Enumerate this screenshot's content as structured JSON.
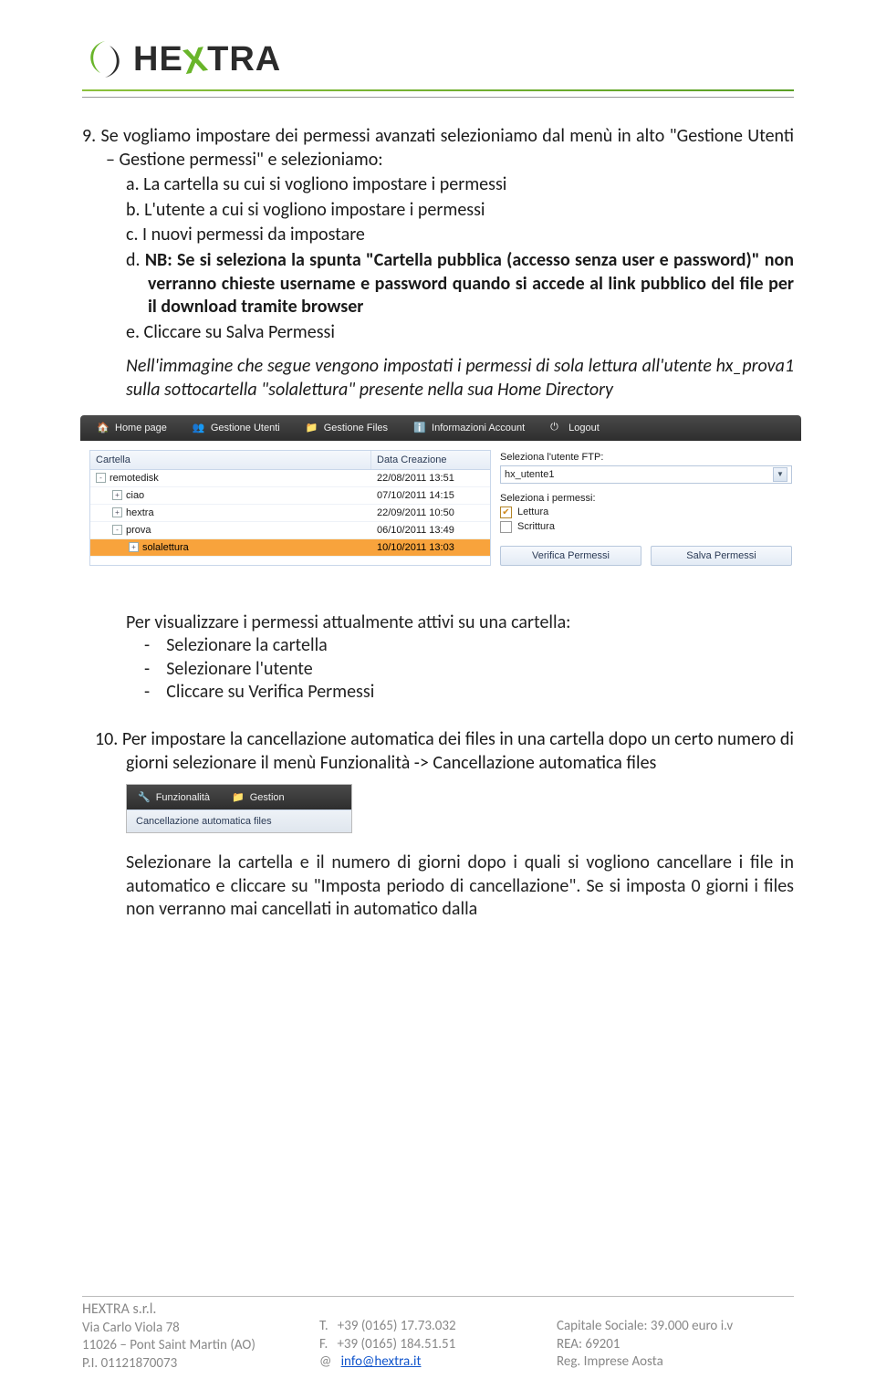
{
  "logo": {
    "text_pre": "HE",
    "text_x": "X",
    "text_post": "TRA"
  },
  "section9": {
    "num": "9.",
    "intro": "Se vogliamo impostare dei permessi avanzati selezioniamo dal menù in alto \"Gestione Utenti – Gestione permessi\" e selezioniamo:",
    "a": "a.",
    "a_txt": "La cartella su cui si vogliono impostare i permessi",
    "b": "b.",
    "b_txt": "L'utente a cui si vogliono impostare i permessi",
    "c": "c.",
    "c_txt": "I nuovi permessi da impostare",
    "d": "d.",
    "d_txt": "NB: Se si seleziona la spunta \"Cartella pubblica (accesso senza user e password)\" non verranno chieste username e password quando si accede al link pubblico del file per il download tramite browser",
    "e": "e.",
    "e_txt": "Cliccare su Salva Permessi",
    "note": "Nell'immagine che segue vengono impostati i permessi di sola lettura all'utente hx_prova1 sulla sottocartella \"solalettura\" presente nella sua Home Directory"
  },
  "shot1": {
    "nav": [
      "Home page",
      "Gestione Utenti",
      "Gestione Files",
      "Informazioni Account",
      "Logout"
    ],
    "cols": [
      "Cartella",
      "Data Creazione"
    ],
    "rows": [
      {
        "exp": "-",
        "indent": 0,
        "name": "remotedisk",
        "date": "22/08/2011 13:51",
        "sel": false
      },
      {
        "exp": "+",
        "indent": 1,
        "name": "ciao",
        "date": "07/10/2011 14:15",
        "sel": false
      },
      {
        "exp": "+",
        "indent": 1,
        "name": "hextra",
        "date": "22/09/2011 10:50",
        "sel": false
      },
      {
        "exp": "-",
        "indent": 1,
        "name": "prova",
        "date": "06/10/2011 13:49",
        "sel": false
      },
      {
        "exp": "+",
        "indent": 2,
        "name": "solalettura",
        "date": "10/10/2011 13:03",
        "sel": true
      }
    ],
    "right": {
      "lbl_user": "Seleziona l'utente FTP:",
      "user": "hx_utente1",
      "lbl_perm": "Seleziona i permessi:",
      "perm_read": "Lettura",
      "perm_write": "Scrittura",
      "btn_verify": "Verifica Permessi",
      "btn_save": "Salva Permessi"
    }
  },
  "mid": {
    "p1": "Per visualizzare i permessi attualmente attivi su una cartella:",
    "d1": "Selezionare la cartella",
    "d2": "Selezionare l'utente",
    "d3": "Cliccare su Verifica Permessi"
  },
  "section10": {
    "num": "10.",
    "txt": "Per impostare la cancellazione automatica dei files in una cartella dopo un certo numero di giorni selezionare il menù Funzionalità -> Cancellazione automatica files"
  },
  "shot2": {
    "nav": [
      "Funzionalità",
      "Gestion"
    ],
    "sub": "Cancellazione automatica files"
  },
  "closing": "Selezionare la cartella e il numero di giorni dopo i quali si vogliono cancellare i file in automatico e cliccare su \"Imposta periodo di cancellazione\". Se si imposta 0 giorni i files non verranno mai cancellati in automatico dalla",
  "footer": {
    "company": "HEXTRA s.r.l.",
    "addr1": "Via Carlo Viola 78",
    "addr2": "11026 – Pont Saint Martin (AO)",
    "addr3": "P.I. 01121870073",
    "t_lbl": "T.",
    "t_val": "+39 (0165) 17.73.032",
    "f_lbl": "F.",
    "f_val": "+39 (0165) 184.51.51",
    "at_lbl": "@",
    "email": "info@hextra.it",
    "cap": "Capitale Sociale: 39.000 euro i.v",
    "rea": "REA: 69201",
    "reg": "Reg. Imprese Aosta"
  }
}
